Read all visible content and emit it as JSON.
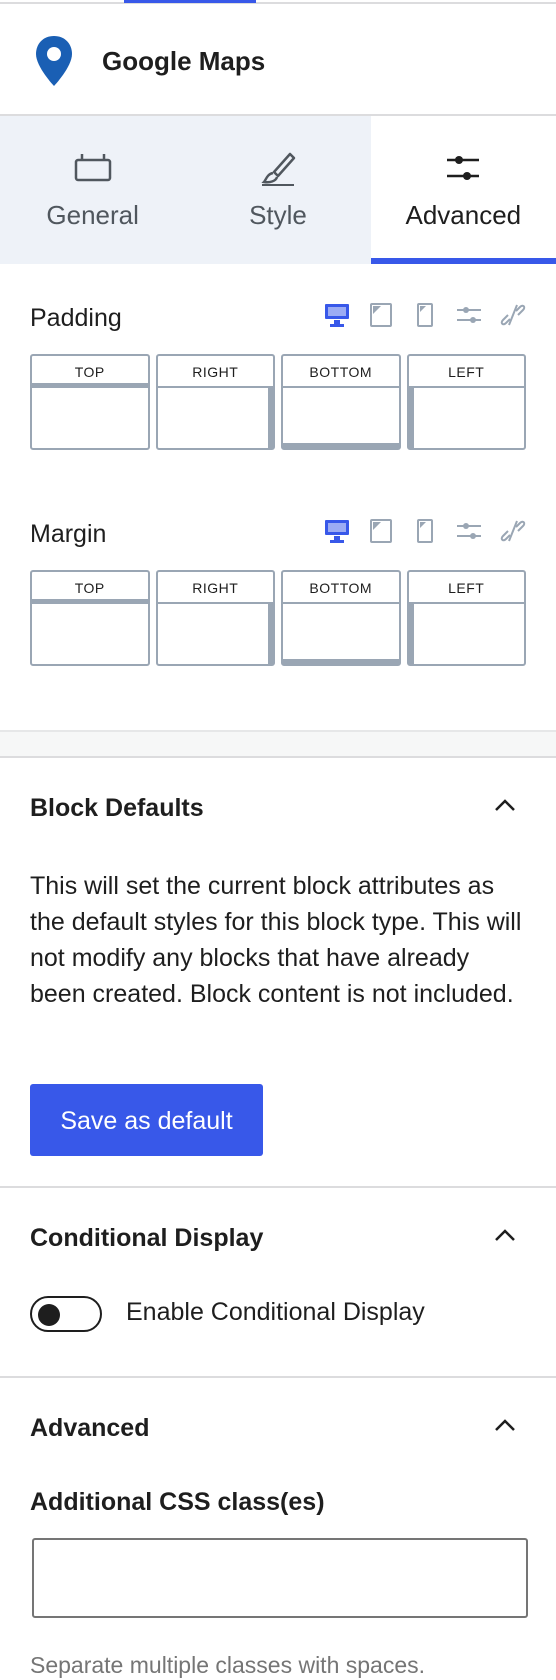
{
  "block": {
    "title": "Google Maps",
    "icon": "map-pin-icon"
  },
  "tabs": [
    {
      "label": "General",
      "icon": "general-icon"
    },
    {
      "label": "Style",
      "icon": "brush-icon"
    },
    {
      "label": "Advanced",
      "icon": "sliders-icon"
    }
  ],
  "active_tab": "Advanced",
  "padding": {
    "label": "Padding",
    "sides": [
      "TOP",
      "RIGHT",
      "BOTTOM",
      "LEFT"
    ]
  },
  "margin": {
    "label": "Margin",
    "sides": [
      "TOP",
      "RIGHT",
      "BOTTOM",
      "LEFT"
    ]
  },
  "device_icons": [
    "desktop-icon",
    "tablet-icon",
    "mobile-icon",
    "units-icon",
    "unlink-icon"
  ],
  "block_defaults": {
    "title": "Block Defaults",
    "description": "This will set the current block attributes as the default styles for this block type. This will not modify any blocks that have already been created. Block content is not included.",
    "button": "Save as default"
  },
  "conditional_display": {
    "title": "Conditional Display",
    "toggle_label": "Enable Conditional Display",
    "enabled": false
  },
  "advanced": {
    "title": "Advanced",
    "css_label": "Additional CSS class(es)",
    "css_value": "",
    "css_help": "Separate multiple classes with spaces."
  },
  "colors": {
    "accent": "#3858e9",
    "tab_bg": "#eef2f8",
    "border": "#9aa6b4"
  }
}
